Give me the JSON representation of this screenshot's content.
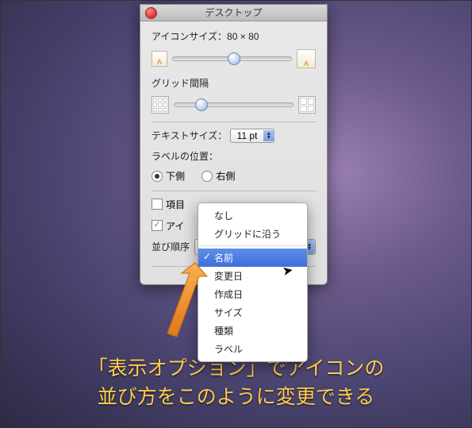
{
  "window": {
    "title": "デスクトップ",
    "iconSizeLabel": "アイコンサイズ：80 × 80",
    "gridSpacingLabel": "グリッド間隔",
    "textSizeLabel": "テキストサイズ：",
    "textSizeValue": "11 pt",
    "labelPositionLabel": "ラベルの位置：",
    "radioBottom": "下側",
    "radioRight": "右側",
    "checkboxItemInfo": "項目",
    "checkboxIconPreview": "アイ",
    "sortLabel": "並び順序"
  },
  "sliderPositions": {
    "iconSize": "52%",
    "gridSpacing": "23%"
  },
  "menu": {
    "items": [
      {
        "label": "なし",
        "selected": false
      },
      {
        "label": "グリッドに沿う",
        "selected": false
      },
      {
        "label": "名前",
        "selected": true
      },
      {
        "label": "変更日",
        "selected": false
      },
      {
        "label": "作成日",
        "selected": false
      },
      {
        "label": "サイズ",
        "selected": false
      },
      {
        "label": "種類",
        "selected": false
      },
      {
        "label": "ラベル",
        "selected": false
      }
    ]
  },
  "annotation": {
    "caption": "「表示オプション」でアイコンの\n並び方をこのように変更できる"
  }
}
